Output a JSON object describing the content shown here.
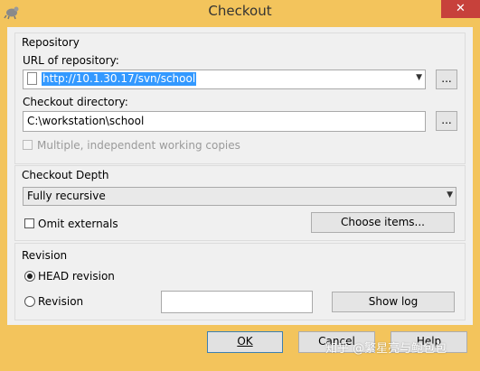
{
  "window": {
    "title": "Checkout",
    "close_glyph": "✕"
  },
  "repository": {
    "group_label": "Repository",
    "url_label": "URL of repository:",
    "url_value": "http://10.1.30.17/svn/school",
    "browse_label": "...",
    "dir_label": "Checkout directory:",
    "dir_value": "C:\\workstation\\school",
    "dir_browse_label": "...",
    "multi_label": "Multiple, independent working copies",
    "multi_checked": false
  },
  "depth": {
    "group_label": "Checkout Depth",
    "selected": "Fully recursive",
    "omit_label": "Omit externals",
    "omit_checked": false,
    "choose_label": "Choose items..."
  },
  "revision": {
    "group_label": "Revision",
    "head_label": "HEAD revision",
    "head_selected": true,
    "rev_label": "Revision",
    "rev_value": "",
    "showlog_label": "Show log"
  },
  "footer": {
    "ok_label": "OK",
    "cancel_label": "Cancel",
    "help_label": "Help"
  },
  "watermark": "知乎 @繁星亮与鲍包包",
  "colors": {
    "frame": "#f3c45c",
    "close": "#c7413b",
    "selection": "#3399ff"
  }
}
